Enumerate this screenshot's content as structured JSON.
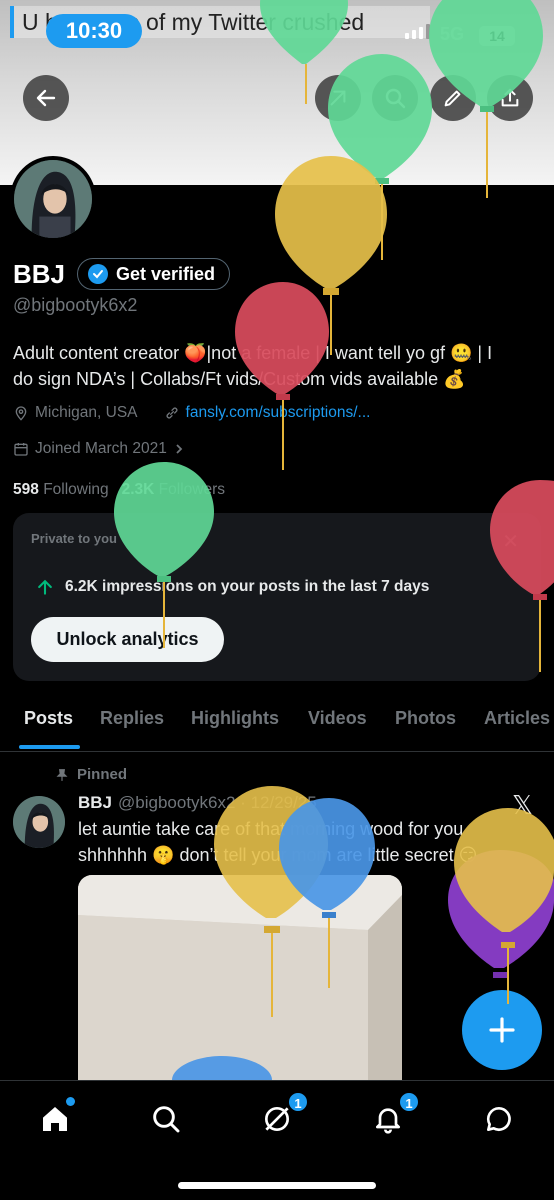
{
  "status_bar": {
    "notification_text": "U have one of my Twitter crushed",
    "time": "10:30",
    "network": "5G",
    "battery": "14"
  },
  "header": {
    "back_icon": "arrow-left-icon",
    "grok_icon": "grok-icon",
    "search_icon": "search-icon",
    "edit_icon": "pencil-icon",
    "share_icon": "share-icon"
  },
  "profile": {
    "display_name": "BBJ",
    "verify_label": "Get verified",
    "handle": "@bigbootyk6x2",
    "bio_line1": "Adult content creator 🍑|not a female | I want tell yo gf 🤐 | I",
    "bio_line2": "do sign NDA’s | Collabs/Ft vids/Custom vids available 💰",
    "location": "Michigan, USA",
    "link": "fansly.com/subscriptions/...",
    "joined": "Joined March 2021",
    "following_count": "598",
    "following_label": "Following",
    "followers_count": "2.3K",
    "followers_label": "Followers"
  },
  "analytics": {
    "private_label": "Private to you",
    "impressions_text": "6.2K impressions on your posts in the last 7 days",
    "unlock_label": "Unlock analytics"
  },
  "tabs": [
    {
      "label": "Posts"
    },
    {
      "label": "Replies"
    },
    {
      "label": "Highlights"
    },
    {
      "label": "Videos"
    },
    {
      "label": "Photos"
    },
    {
      "label": "Articles"
    }
  ],
  "post": {
    "pinned_label": "Pinned",
    "author": "BBJ",
    "meta": "@bigbootyk6x2 · 12/29/25",
    "line1": "let auntie take care of that morning wood for you",
    "line2": "shhhhhh 🤫 don’t tell your mom are little secret 😏"
  },
  "bottom_nav": {
    "messages_badge": "1",
    "notifications_badge": "1"
  },
  "colors": {
    "accent": "#1d9bf0",
    "background": "#000000",
    "muted_text": "#71767b"
  }
}
